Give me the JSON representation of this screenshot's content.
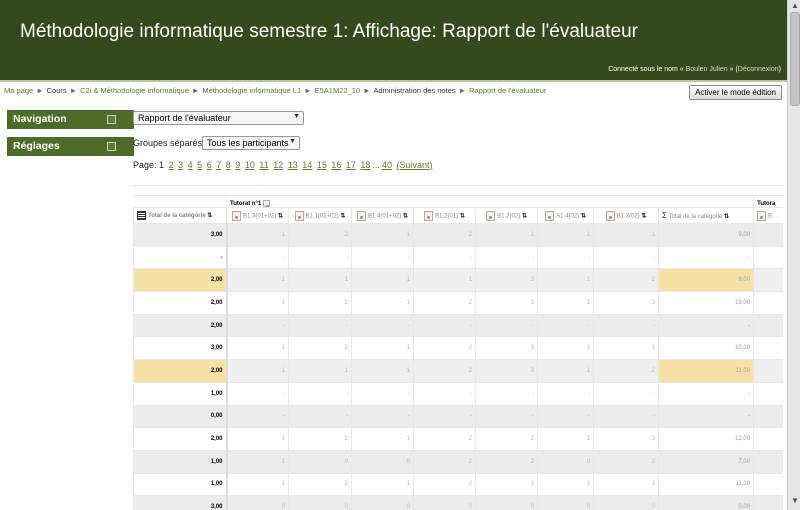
{
  "header": {
    "title": "Méthodologie informatique semestre 1: Affichage: Rapport de l'évaluateur",
    "login_prefix": "Connecté sous le nom « ",
    "login_user": "Boulen Julien",
    "login_mid": " » (",
    "login_logout": "Déconnexion",
    "login_suffix": ")"
  },
  "breadcrumb": [
    {
      "label": "Ma page",
      "link": true
    },
    {
      "label": "Cours",
      "link": false
    },
    {
      "label": "C2i & Méthodologie informatique",
      "link": true
    },
    {
      "label": "Méthodologie informatique L1",
      "link": true
    },
    {
      "label": "E5A1M22_10",
      "link": true
    },
    {
      "label": "Administration des notes",
      "link": false
    },
    {
      "label": "Rapport de l'évaluateur",
      "link": true
    }
  ],
  "breadcrumb_sep": "►",
  "edit_button": "Activer le mode édition",
  "blocks": {
    "navigation": "Navigation",
    "settings": "Réglages"
  },
  "report_select": "Rapport de l'évaluateur",
  "groups": {
    "label": "Groupes séparés",
    "selected": "Tous les participants"
  },
  "paging": {
    "label": "Page:",
    "current": "1",
    "pages": [
      "2",
      "3",
      "4",
      "5",
      "6",
      "7",
      "8",
      "9",
      "10",
      "11",
      "12",
      "13",
      "14",
      "15",
      "16",
      "17",
      "18"
    ],
    "ellipsis": "...",
    "last": "40",
    "next": "(Suivant)"
  },
  "table": {
    "group_header": "Tutorat n°1",
    "next_group_header": "Tutora",
    "total_label": "Total de la catégorie",
    "columns": [
      "B1.3(01+02)",
      "B1.1(01+02)",
      "B1.4(01+02)",
      "B1.2(01)",
      "B1.2(02)",
      "A1.4(02)",
      "B1.3(02)"
    ],
    "sum_label": "Total de la catégorie",
    "next_col": "B",
    "rows": [
      {
        "first": "3,00",
        "vals": [
          "1",
          "2",
          "1",
          "2",
          "1",
          "1",
          "1"
        ],
        "sum": "9,00",
        "style": "alt"
      },
      {
        "first": "-",
        "vals": [
          "-",
          "-",
          "-",
          "-",
          "-",
          "-",
          "-"
        ],
        "sum": "-",
        "style": ""
      },
      {
        "first": "2,00",
        "vals": [
          "1",
          "1",
          "1",
          "1",
          "2",
          "1",
          "2"
        ],
        "sum": "9,00",
        "style": "hl"
      },
      {
        "first": "2,00",
        "vals": [
          "1",
          "2",
          "1",
          "2",
          "3",
          "1",
          "3"
        ],
        "sum": "13,00",
        "style": ""
      },
      {
        "first": "2,00",
        "vals": [
          "-",
          "-",
          "-",
          "-",
          "-",
          "-",
          "-"
        ],
        "sum": "-",
        "style": "alt"
      },
      {
        "first": "3,00",
        "vals": [
          "1",
          "2",
          "1",
          "2",
          "3",
          "1",
          "1"
        ],
        "sum": "10,00",
        "style": ""
      },
      {
        "first": "2,00",
        "vals": [
          "1",
          "1",
          "1",
          "2",
          "3",
          "1",
          "2"
        ],
        "sum": "11,00",
        "style": "hl"
      },
      {
        "first": "1,00",
        "vals": [
          "-",
          "-",
          "-",
          "-",
          "-",
          "-",
          "-"
        ],
        "sum": "-",
        "style": ""
      },
      {
        "first": "0,00",
        "vals": [
          "-",
          "-",
          "-",
          "-",
          "-",
          "-",
          "-"
        ],
        "sum": "-",
        "style": "alt"
      },
      {
        "first": "2,00",
        "vals": [
          "1",
          "2",
          "1",
          "2",
          "2",
          "1",
          "3"
        ],
        "sum": "12,00",
        "style": ""
      },
      {
        "first": "1,00",
        "vals": [
          "1",
          "0",
          "0",
          "2",
          "2",
          "0",
          "2"
        ],
        "sum": "7,00",
        "style": "alt"
      },
      {
        "first": "1,00",
        "vals": [
          "1",
          "2",
          "1",
          "2",
          "1",
          "1",
          "3"
        ],
        "sum": "11,00",
        "style": ""
      },
      {
        "first": "3,00",
        "vals": [
          "0",
          "0",
          "0",
          "0",
          "0",
          "0",
          "0"
        ],
        "sum": "0,00",
        "style": "alt"
      }
    ]
  },
  "colors": {
    "header_bg": "#354a1c",
    "block_bg": "#4e6b2a",
    "link": "#5f7a32",
    "highlight": "#f6e2a6"
  }
}
